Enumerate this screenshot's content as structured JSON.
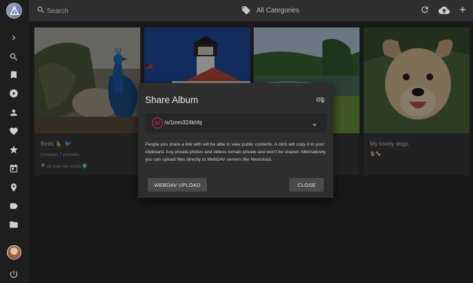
{
  "topbar": {
    "search_placeholder": "Search",
    "category_label": "All Categories",
    "icons": [
      "search-icon",
      "tag-icon",
      "refresh-icon",
      "cloud-upload-icon",
      "add-icon"
    ]
  },
  "sidebar": {
    "items": [
      {
        "icon": "chevron-right-icon"
      },
      {
        "icon": "search-icon"
      },
      {
        "icon": "bookmark-icon"
      },
      {
        "icon": "play-icon"
      },
      {
        "icon": "person-icon"
      },
      {
        "icon": "heart-icon"
      },
      {
        "icon": "star-icon"
      },
      {
        "icon": "calendar-icon"
      },
      {
        "icon": "place-icon"
      },
      {
        "icon": "label-icon"
      },
      {
        "icon": "folder-icon"
      },
      {
        "icon": "power-icon"
      }
    ]
  },
  "albums": [
    {
      "title": "Birds 🦜 🐦",
      "subtitle": "Contains 7 pictures.",
      "location": "All over the world 🌍"
    },
    {
      "title": "",
      "subtitle": "",
      "location": ""
    },
    {
      "title": "",
      "subtitle": "",
      "location": ""
    },
    {
      "title": "My lovely dogs",
      "subtitle": "🐕🦴",
      "location": ""
    }
  ],
  "dialog": {
    "title": "Share Album",
    "link_value": "/s/1mm324khfq",
    "description": "People you share a link with will be able to view public contents. A click will copy it to your clipboard. Any private photos and videos remain private and won't be shared. Alternatively, you can upload files directly to WebDAV servers like Nextcloud.",
    "webdav_button": "WEBDAV UPLOAD",
    "close_button": "CLOSE"
  },
  "colors": {
    "accent": "#e0256b",
    "dialog_bg": "#2e2e2e",
    "sidebar_bg": "#1e1e1e"
  }
}
